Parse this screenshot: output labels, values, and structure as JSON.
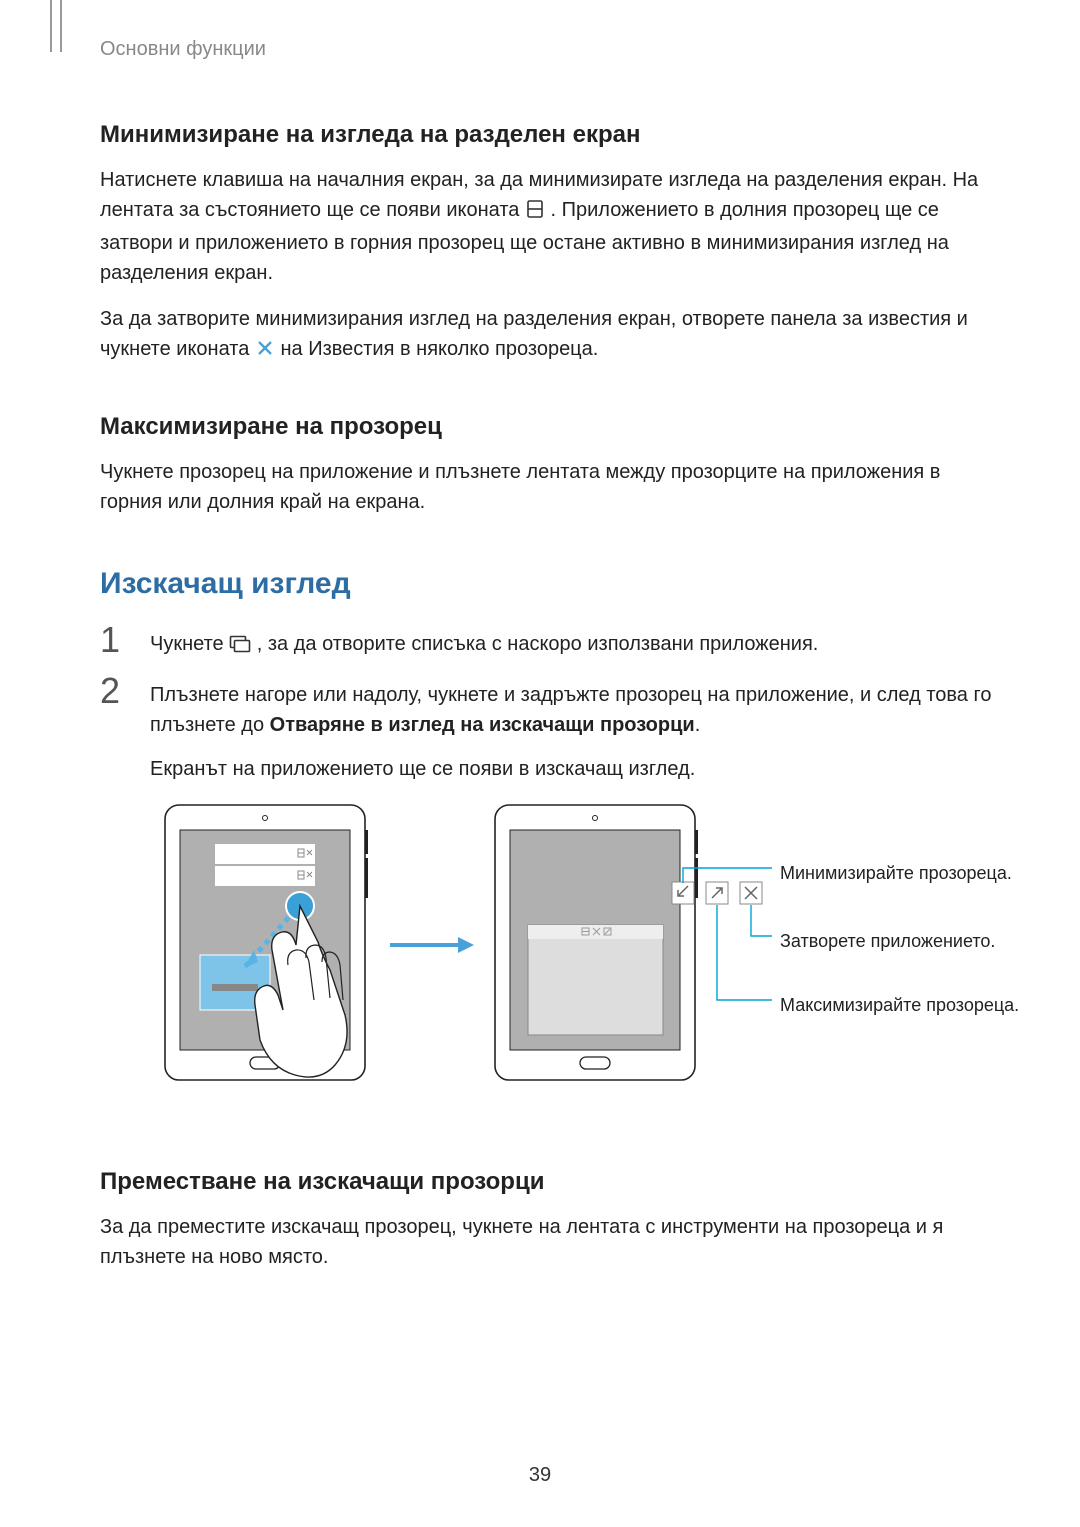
{
  "header": {
    "section": "Основни функции"
  },
  "sec1": {
    "title": "Минимизиране на изгледа на разделен екран",
    "p1a": "Натиснете клавиша на началния екран, за да минимизирате изгледа на разделения екран. На лентата за състоянието ще се появи иконата ",
    "p1b": ". Приложението в долния прозорец ще се затвори и приложението в горния прозорец ще остане активно в минимизирания изглед на разделения екран.",
    "p2a": "За да затворите минимизирания изглед на разделения екран, отворете панела за известия и чукнете иконата ",
    "p2b": " на Известия в няколко прозореца."
  },
  "sec2": {
    "title": "Максимизиране на прозорец",
    "p1": "Чукнете прозорец на приложение и плъзнете лентата между прозорците на приложения в горния или долния край на екрана."
  },
  "sec3": {
    "title": "Изскачащ изглед",
    "step1a": "Чукнете ",
    "step1b": ", за да отворите списъка с наскоро използвани приложения.",
    "step2a": "Плъзнете нагоре или надолу, чукнете и задръжте прозорец на приложение, и след това го плъзнете до ",
    "step2bold": "Отваряне в изглед на изскачащи прозорци",
    "step2b": ".",
    "step2_p2": "Екранът на приложението ще се появи в изскачащ изглед."
  },
  "callouts": {
    "minimize": "Минимизирайте прозореца.",
    "close": "Затворете приложението.",
    "maximize": "Максимизирайте прозореца."
  },
  "sec4": {
    "title": "Преместване на изскачащи прозорци",
    "p1": "За да преместите изскачащ прозорец, чукнете на лентата с инструменти на прозореца и я плъзнете на ново място."
  },
  "page_number": "39"
}
